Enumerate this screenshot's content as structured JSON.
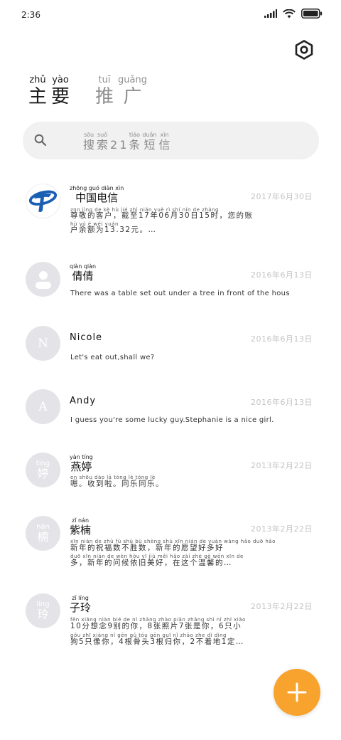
{
  "status_bar": {
    "time": "2:36"
  },
  "tabs": [
    {
      "label": "主要",
      "pinyin": [
        "zhǔ",
        "yào"
      ],
      "chars": [
        "主",
        "要"
      ]
    },
    {
      "label": "推广",
      "pinyin": [
        "tuī",
        "guǎng"
      ],
      "chars": [
        "推",
        "广"
      ]
    }
  ],
  "search": {
    "placeholder": "搜索21条短信",
    "pinyin": [
      "sōu",
      "suǒ",
      "",
      "",
      "tiáo",
      "duǎn",
      "xìn"
    ],
    "chars": [
      "搜",
      "索",
      "2",
      "1",
      "条",
      "短",
      "信"
    ]
  },
  "conversations": [
    {
      "name": "中国电信",
      "name_pinyin": "zhōng guó diàn xìn",
      "date": "2017年6月30日",
      "message_line1": "尊敬的客户，截至17年06月30日15时，您的账",
      "message_line2": "户余额为13.32元。…",
      "message_pinyin1": "zūn jìng de kè hù jié zhì nián yuè rì shí nín de zhàng",
      "message_pinyin2": "hù yú é wéi yuán",
      "avatar_type": "logo"
    },
    {
      "name": "倩倩",
      "name_pinyin": "qiàn qiàn",
      "date": "2016年6月13日",
      "message_line1": "There was a table set out under a tree in front of the hous",
      "avatar_type": "person"
    },
    {
      "name": "Nicole",
      "date": "2016年6月13日",
      "message_line1": "Let's eat out,shall we?",
      "avatar_letter": "N",
      "avatar_type": "letter"
    },
    {
      "name": "Andy",
      "date": "2016年6月13日",
      "message_line1": "I guess you're some lucky guy.Stephanie is a nice girl.",
      "avatar_letter": "A",
      "avatar_type": "letter"
    },
    {
      "name": "燕婷",
      "name_pinyin": "yàn tíng",
      "date": "2013年2月22日",
      "message_line1": "嗯。收到啦。同乐同乐。",
      "message_pinyin1": "en shōu dào lā tóng lè tóng lè",
      "avatar_py": "tíng",
      "avatar_hz": "婷",
      "avatar_type": "char"
    },
    {
      "name": "紫楠",
      "name_pinyin": "zǐ nán",
      "date": "2013年2月22日",
      "message_line1": "新年的祝福数不胜数，新年的愿望好多好",
      "message_line2": "多，新年的问候依旧美好，在这个温馨的…",
      "message_pinyin1": "xīn nián de zhù fú shù bù shèng shù xīn nián de yuàn wàng hǎo duō hǎo",
      "message_pinyin2": "duō xīn nián de wèn hòu yī jiù měi hǎo zài zhè gè wēn xīn de",
      "avatar_py": "nán",
      "avatar_hz": "楠",
      "avatar_type": "char"
    },
    {
      "name": "子玲",
      "name_pinyin": "zǐ líng",
      "date": "2013年2月22日",
      "message_line1": "10分想念9别的你，8张照片7张是你，6只小",
      "message_line2": "狗5只像你，4根骨头3根归你，2不着地1定…",
      "message_pinyin1": "fēn xiǎng niàn bié de nǐ zhāng zhào piān zhāng shì nǐ zhī xiǎo",
      "message_pinyin2": "gǒu zhī xiàng nǐ gēn gǔ tóu gēn guī nǐ zhāo zhe dì dìng",
      "avatar_py": "líng",
      "avatar_hz": "玲",
      "avatar_type": "char"
    }
  ],
  "colors": {
    "accent": "#f7a32e",
    "logo_blue": "#1a5fb4",
    "avatar_bg": "#e4e4e8",
    "date": "#c4c4c4"
  },
  "icons": {
    "settings": "hexagon-gear-icon",
    "search": "search-icon",
    "fab": "plus-icon"
  }
}
